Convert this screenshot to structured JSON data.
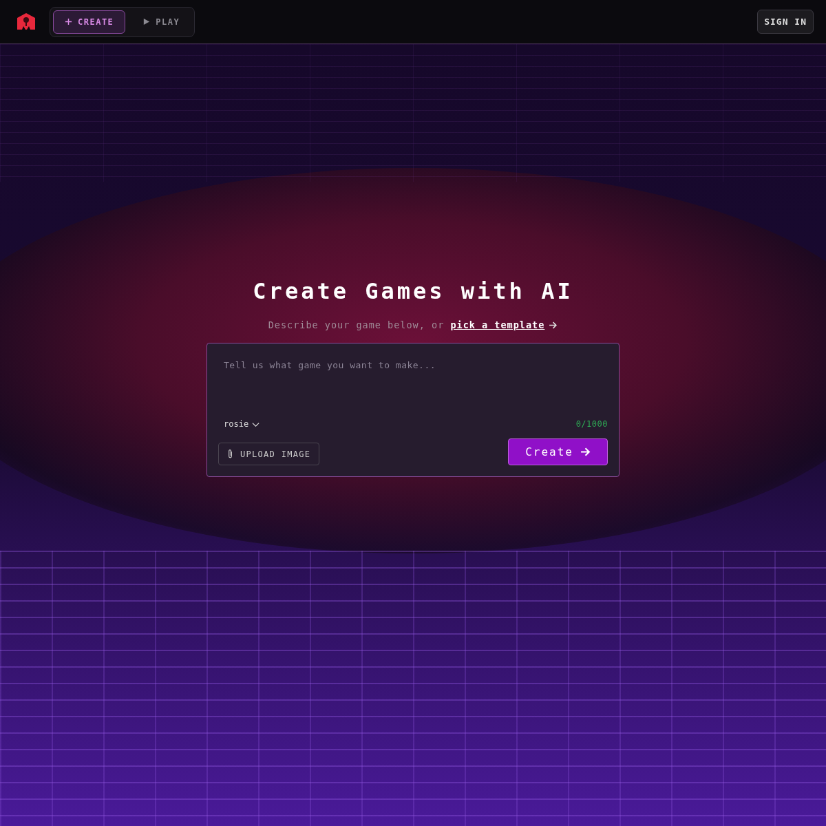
{
  "nav": {
    "tabs": [
      {
        "label": "CREATE",
        "selected": true,
        "kind": "create"
      },
      {
        "label": "PLAY",
        "selected": false,
        "kind": "play"
      }
    ],
    "sign_in": "SIGN IN"
  },
  "hero": {
    "title": "Create Games with AI",
    "subtitle": "Describe your game below, or",
    "link": "pick a template"
  },
  "prompt": {
    "placeholder": "Tell us what game you want to make...",
    "model": "rosie",
    "counter": "0/1000",
    "upload": "UPLOAD IMAGE",
    "submit": "Create"
  }
}
